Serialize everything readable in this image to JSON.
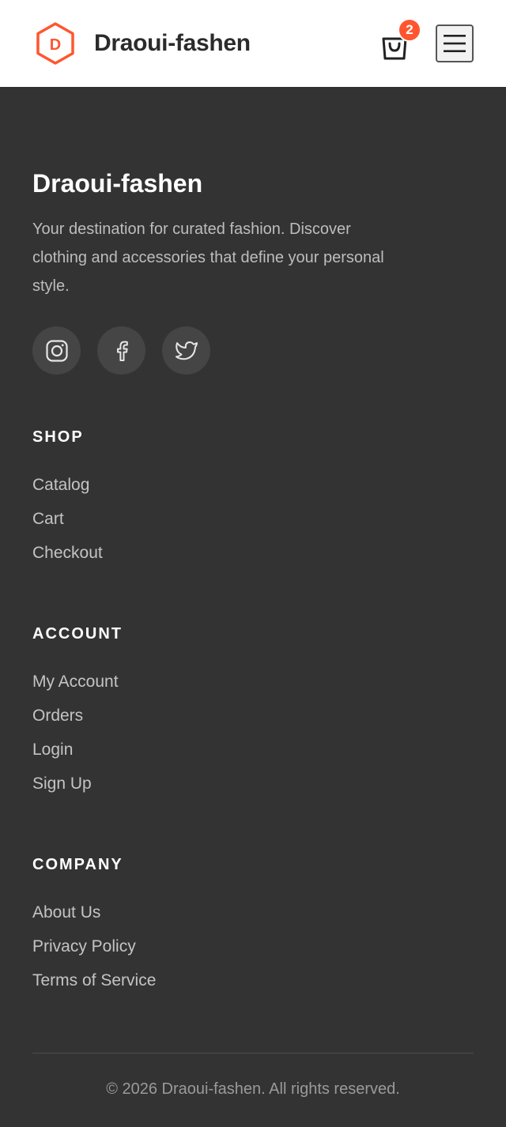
{
  "header": {
    "logo_letter": "D",
    "brand": "Draoui-fashen",
    "cart_count": "2"
  },
  "footer": {
    "brand": "Draoui-fashen",
    "description": "Your destination for curated fashion. Discover clothing and accessories that define your personal style.",
    "socials": [
      "instagram-icon",
      "facebook-icon",
      "twitter-icon"
    ],
    "shop": {
      "title": "Shop",
      "links": [
        "Catalog",
        "Cart",
        "Checkout"
      ]
    },
    "account": {
      "title": "Account",
      "links": [
        "My Account",
        "Orders",
        "Login",
        "Sign Up"
      ]
    },
    "company": {
      "title": "Company",
      "links": [
        "About Us",
        "Privacy Policy",
        "Terms of Service"
      ]
    },
    "copyright": "© 2026 Draoui-fashen. All rights reserved."
  },
  "colors": {
    "accent": "#ff5630",
    "footer_bg": "#333333",
    "header_bg": "#ffffff"
  }
}
